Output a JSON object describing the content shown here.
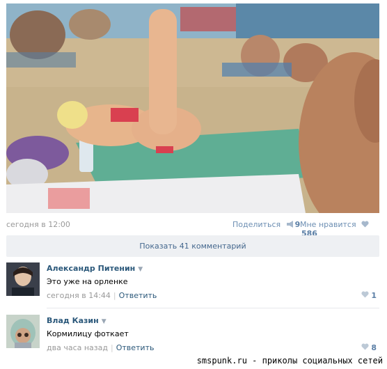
{
  "post": {
    "photo_icon": "beach-photo",
    "time": "сегодня в 12:00",
    "share_label": "Поделиться",
    "share_count": "9",
    "like_label": "Мне нравится",
    "like_count": "586"
  },
  "comments_toggle": {
    "label": "Показать 41 комментарий"
  },
  "comments": [
    {
      "author": "Александр Питенин",
      "text": "Это уже на орленке",
      "time": "сегодня в 14:44",
      "reply": "Ответить",
      "likes": "1"
    },
    {
      "author": "Влад Казин",
      "text": "Кормилицу фоткает",
      "time": "два часа назад",
      "reply": "Ответить",
      "likes": "8"
    }
  ],
  "watermark": "smspunk.ru - приколы социальных сетей",
  "colors": {
    "link": "#2b587a",
    "meta": "#999999",
    "toggle_bg": "#eef0f3"
  }
}
